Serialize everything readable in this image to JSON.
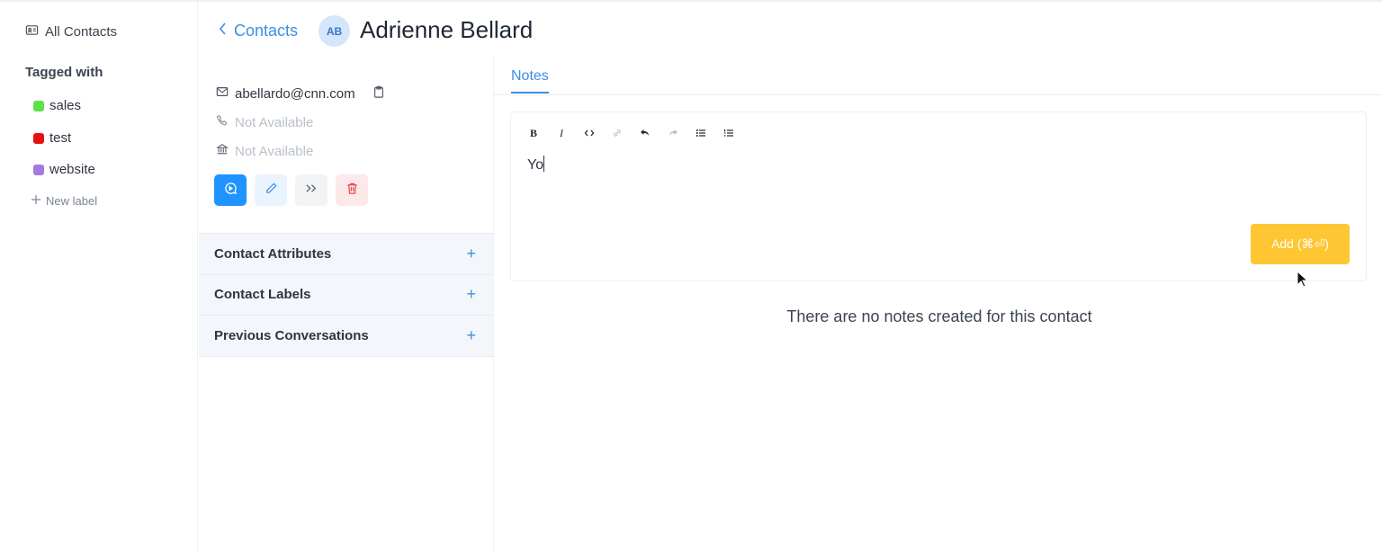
{
  "sidebar": {
    "all_contacts": "All Contacts",
    "tagged_with": "Tagged with",
    "labels": [
      {
        "name": "sales",
        "color": "#5ee04a"
      },
      {
        "name": "test",
        "color": "#e51111"
      },
      {
        "name": "website",
        "color": "#a67ae0"
      }
    ],
    "new_label": "New label"
  },
  "header": {
    "back_label": "Contacts",
    "avatar_initials": "AB",
    "contact_name": "Adrienne Bellard"
  },
  "contact": {
    "email": "abellardo@cnn.com",
    "phone": "Not Available",
    "company": "Not Available",
    "sections": [
      {
        "title": "Contact Attributes"
      },
      {
        "title": "Contact Labels"
      },
      {
        "title": "Previous Conversations"
      }
    ]
  },
  "notes": {
    "tab_label": "Notes",
    "editor_text": "Yo",
    "add_button": "Add (⌘⏎)",
    "empty_message": "There are no notes created for this contact"
  },
  "colors": {
    "accent": "#1f93ff",
    "link": "#3b8fe0",
    "add_button": "#fdc632"
  },
  "icons": {
    "toolbar": [
      "bold-icon",
      "italic-icon",
      "code-icon",
      "link-icon",
      "undo-icon",
      "redo-icon",
      "bullet-list-icon",
      "ordered-list-icon"
    ]
  }
}
